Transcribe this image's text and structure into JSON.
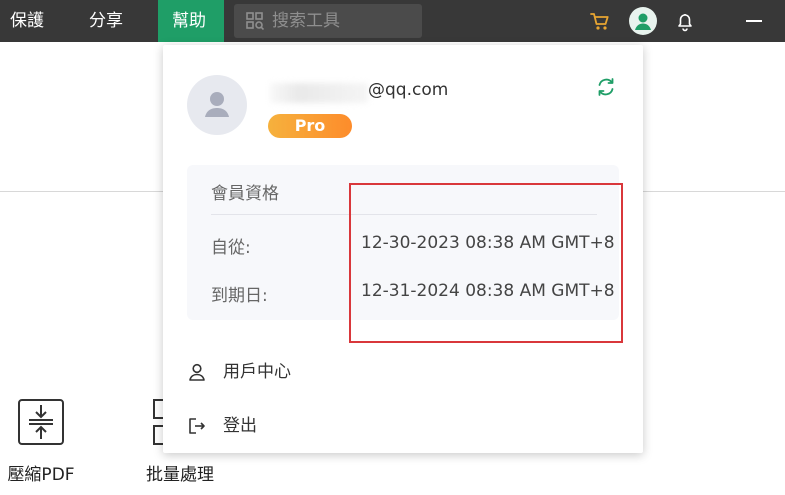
{
  "menu": {
    "protect": "保護",
    "share": "分享",
    "help": "幫助"
  },
  "search": {
    "placeholder": "搜索工具"
  },
  "tools": {
    "compress": "壓縮PDF",
    "batch": "批量處理"
  },
  "account": {
    "email_suffix": "@qq.com",
    "badge": "Pro"
  },
  "membership": {
    "title": "會員資格",
    "from_label": "自從:",
    "from_value": "12-30-2023 08:38 AM GMT+8",
    "until_label": "到期日:",
    "until_value": "12-31-2024 08:38 AM GMT+8"
  },
  "dropdown_menu": {
    "user_center": "用戶中心",
    "logout": "登出"
  },
  "icons": {
    "cart": "cart-icon",
    "avatar": "user-avatar-icon",
    "bell": "bell-icon",
    "minimize": "minimize-icon",
    "refresh": "refresh-icon"
  },
  "colors": {
    "accent": "#1f9e67",
    "highlight": "#d9373b",
    "badge": "#fd8c2b",
    "cart": "#e8a531"
  }
}
